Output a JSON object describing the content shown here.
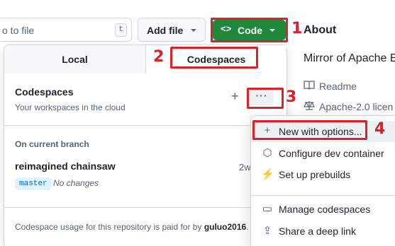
{
  "toolbar": {
    "search_text": "o to file",
    "search_shortcut": "t",
    "add_file_label": "Add file",
    "code_icon": "<>",
    "code_label": "Code"
  },
  "sidebar": {
    "about_title": "About",
    "description": "Mirror of Apache E",
    "readme_label": "Readme",
    "license_label": "Apache-2.0 licen"
  },
  "panel": {
    "tabs": {
      "local": "Local",
      "codespaces": "Codespaces"
    },
    "codespaces_title": "Codespaces",
    "codespaces_subtitle": "Your workspaces in the cloud",
    "add_icon": "+",
    "more_icon": "···",
    "section_heading": "On current branch",
    "codespace": {
      "name": "reimagined chainsaw",
      "time": "2w",
      "branch": "master",
      "status": "No changes"
    },
    "usage_prefix": "Codespace usage for this repository is paid for by ",
    "usage_user": "guluo2016",
    "usage_suffix": "."
  },
  "submenu": {
    "items": [
      {
        "icon": "+",
        "label": "New with options..."
      },
      {
        "icon": "⬡",
        "label": "Configure dev container"
      },
      {
        "icon": "⚡",
        "label": "Set up prebuilds"
      },
      {
        "icon": "▭",
        "label": "Manage codespaces"
      },
      {
        "icon": "⇪",
        "label": "Share a deep link"
      }
    ]
  },
  "annotations": {
    "step1": "1",
    "step2": "2",
    "step3": "3",
    "step4": "4",
    "color": "#d9232a"
  },
  "colors": {
    "primary_green": "#1f883d",
    "muted_text": "#59636e",
    "border": "#d0d7de"
  }
}
